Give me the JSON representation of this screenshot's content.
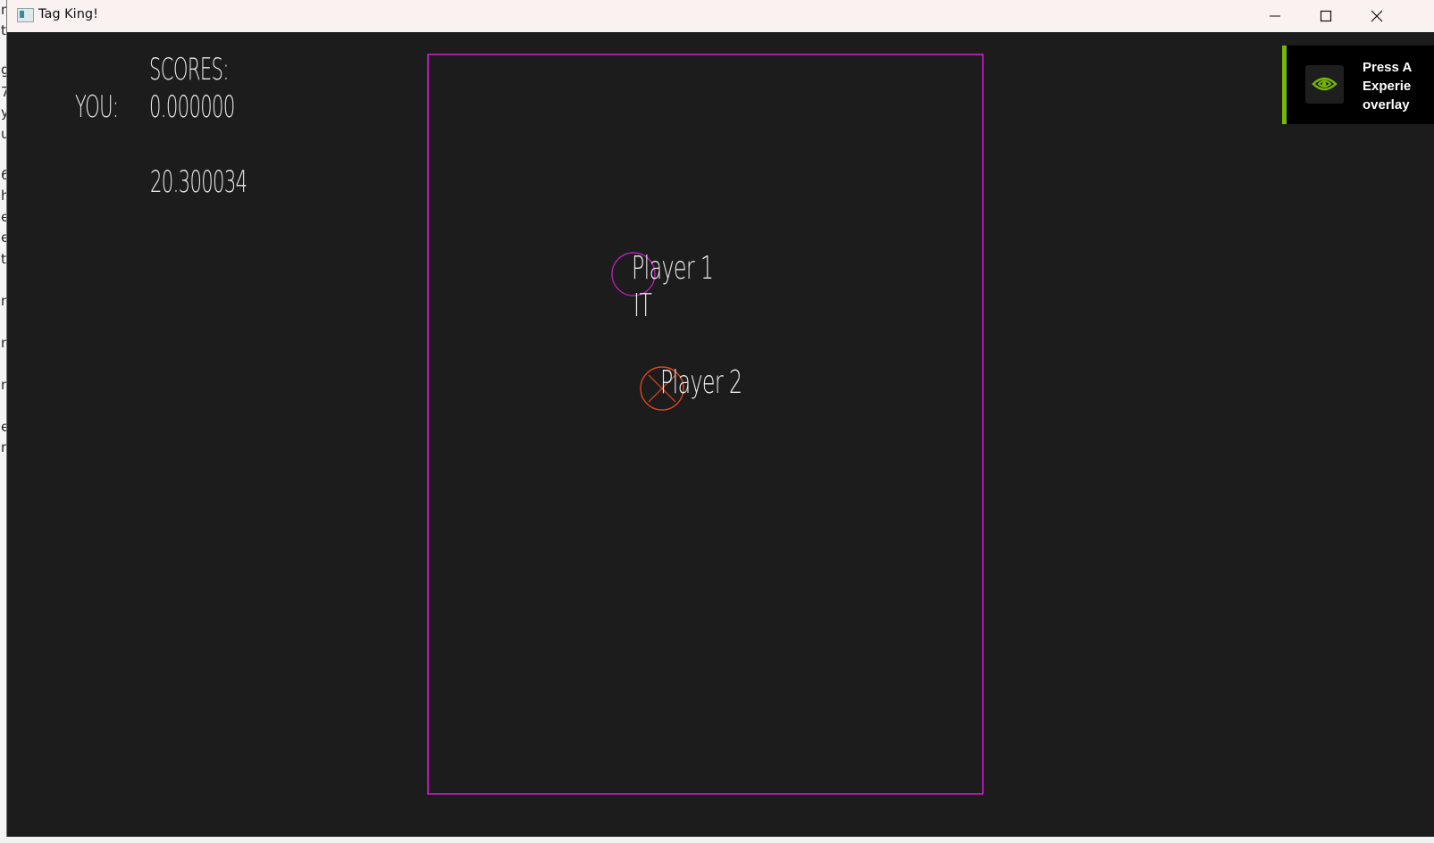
{
  "window": {
    "title": "Tag King!",
    "controls": [
      "minimize",
      "maximize",
      "close"
    ]
  },
  "hud": {
    "scores_label": "SCORES:",
    "you_label": "YOU:",
    "you_score": "0.000000",
    "other_score": "20.300034"
  },
  "arena": {
    "border_color": "#d417d4"
  },
  "players": [
    {
      "name": "Player 1",
      "status": "IT",
      "color": "#b221b2",
      "marker": "circle"
    },
    {
      "name": "Player 2",
      "status": "",
      "color": "#e0451c",
      "marker": "circle-x"
    }
  ],
  "notification": {
    "lines": [
      "Press A",
      "Experie",
      "overlay"
    ],
    "accent_color": "#76b900",
    "icon": "nvidia-icon"
  },
  "background_desktop_text": [
    "n",
    "t",
    "g",
    "7",
    "y",
    "u",
    "6",
    "h",
    "e",
    "e",
    "t",
    "n",
    "n",
    "n",
    "e",
    "n"
  ]
}
